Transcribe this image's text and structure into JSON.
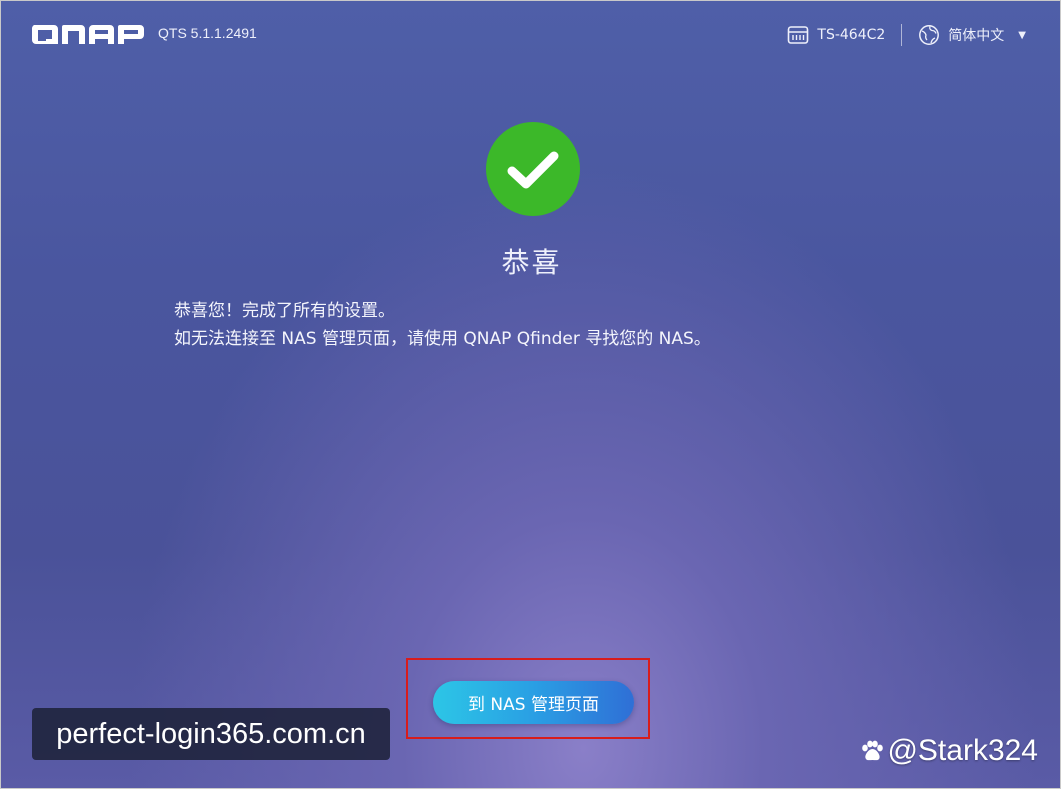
{
  "header": {
    "logo_text": "QNAP",
    "version": "QTS 5.1.1.2491",
    "device": "TS-464C2",
    "language": "简体中文"
  },
  "main": {
    "title": "恭喜",
    "message_line1": "恭喜您！完成了所有的设置。",
    "message_line2": "如无法连接至 NAS 管理页面，请使用 QNAP Qfinder 寻找您的 NAS。",
    "button_label": "到 NAS 管理页面"
  },
  "watermarks": {
    "left": "perfect-login365.com.cn",
    "right": "@Stark324"
  },
  "icons": {
    "success": "check-circle-icon",
    "device": "nas-device-icon",
    "language": "globe-icon",
    "dropdown": "caret-down-icon",
    "watermark_right": "paw-icon"
  },
  "colors": {
    "success_green": "#3cb829",
    "button_start": "#2cc6e6",
    "button_end": "#2f6fd6",
    "highlight_red": "#d81c1c"
  }
}
